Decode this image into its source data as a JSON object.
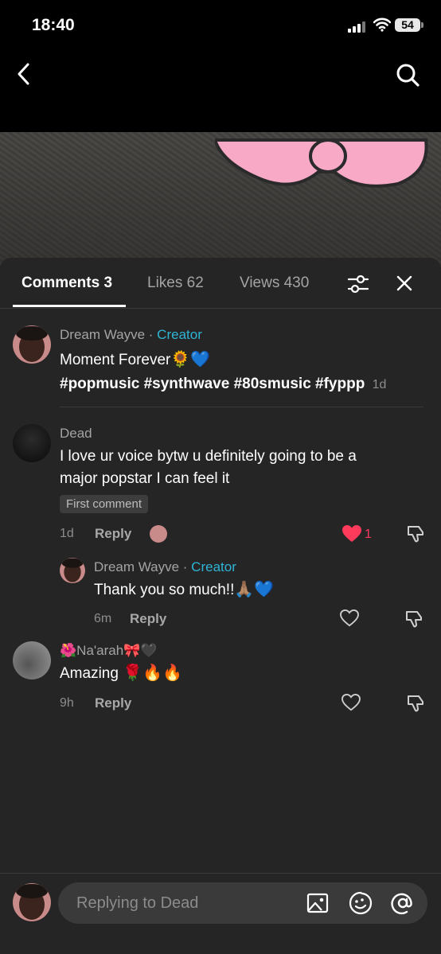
{
  "status_bar": {
    "time": "18:40",
    "battery": "54"
  },
  "tabs": [
    {
      "label": "Comments 3"
    },
    {
      "label": "Likes 62"
    },
    {
      "label": "Views 430"
    }
  ],
  "comments": [
    {
      "author": "Dream Wayve",
      "creator_label": "Creator",
      "line1": "Moment Forever",
      "line1_emoji": "🌻💙",
      "line2": "#popmusic #synthwave #80smusic #fyppp",
      "time": "1d"
    },
    {
      "author": "Dead",
      "line1": "I love ur voice bytw u definitely going to be a",
      "line2": "major popstar I can feel it",
      "badge": "First comment",
      "time": "1d",
      "reply_label": "Reply",
      "like_count": "1",
      "replies": [
        {
          "author": "Dream Wayve",
          "creator_label": "Creator",
          "text": "Thank you so much!!",
          "text_emoji": "🙏🏽💙",
          "time": "6m",
          "reply_label": "Reply"
        }
      ]
    },
    {
      "author_prefix_emoji": "🌺",
      "author": "Na'arah",
      "author_suffix_emoji": "🎀🖤",
      "text": "Amazing",
      "text_emoji": "🌹🔥🔥",
      "time": "9h",
      "reply_label": "Reply"
    }
  ],
  "composer": {
    "placeholder": "Replying to Dead"
  },
  "icons": {
    "back": "chevron-left-icon",
    "search": "search-icon",
    "filter": "sliders-icon",
    "close": "close-icon",
    "heart": "heart-icon",
    "dislike": "thumbs-down-icon",
    "image": "image-icon",
    "sticker": "sticker-icon",
    "mention": "at-sign-icon"
  },
  "colors": {
    "accent_creator": "#2fb5d6",
    "like_red": "#ff3b5c",
    "sheet_bg": "#252525"
  }
}
